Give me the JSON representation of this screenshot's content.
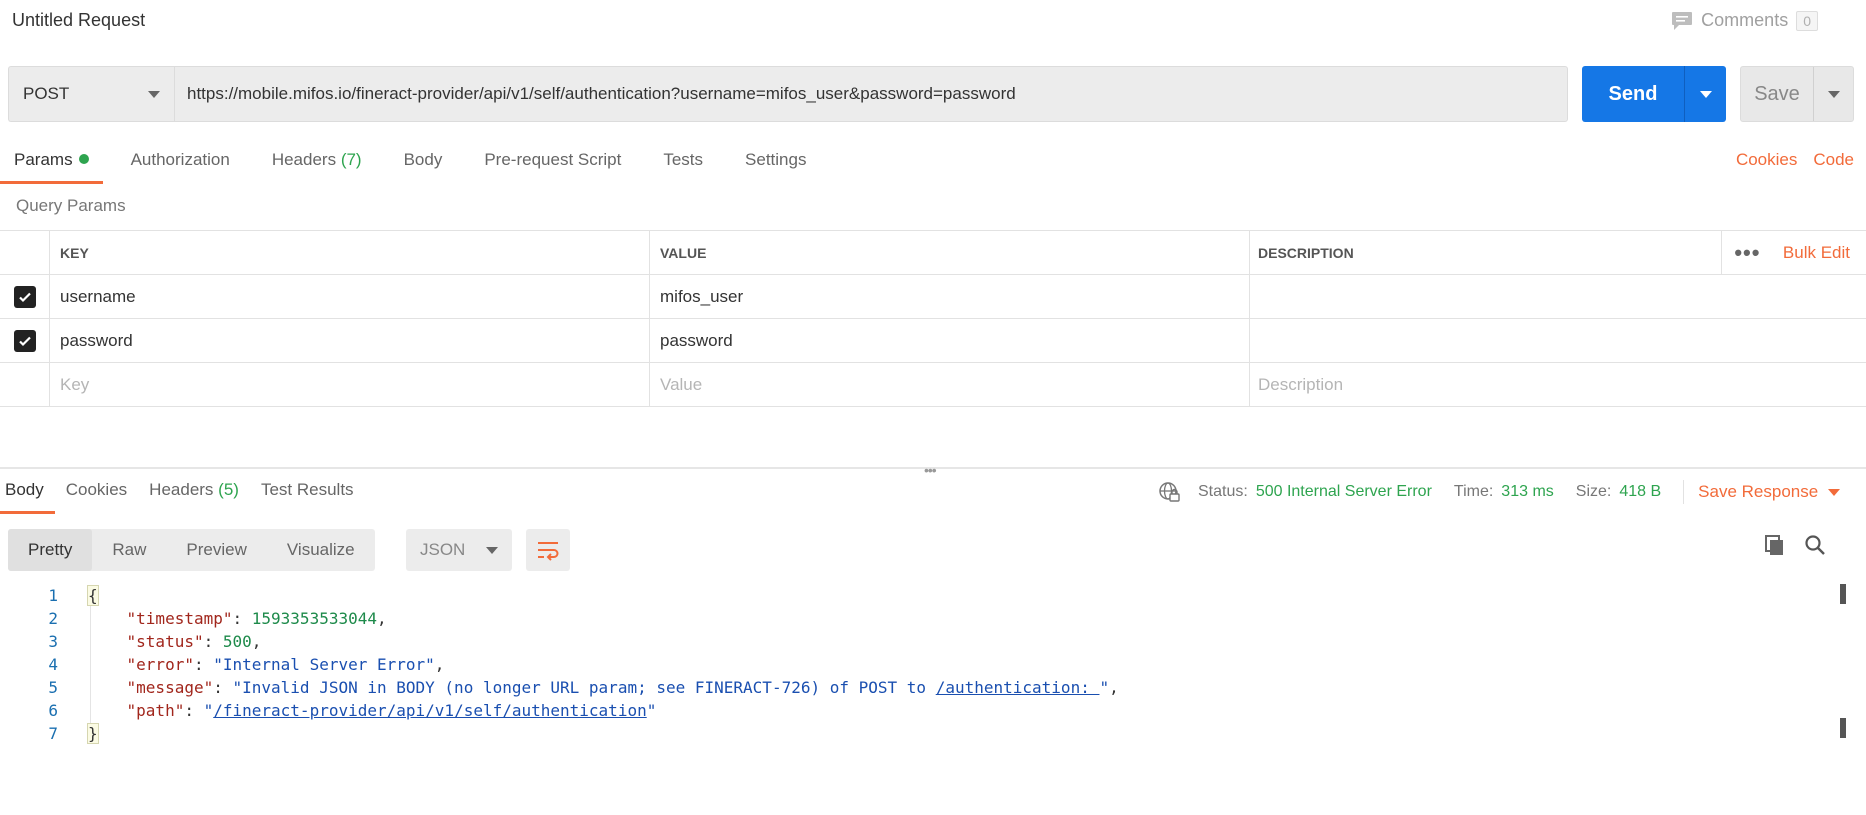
{
  "header": {
    "title": "Untitled Request",
    "comments_label": "Comments",
    "comments_count": "0"
  },
  "request": {
    "method": "POST",
    "url": "https://mobile.mifos.io/fineract-provider/api/v1/self/authentication?username=mifos_user&password=password",
    "send_label": "Send",
    "save_label": "Save"
  },
  "request_tabs": [
    {
      "label": "Params",
      "active": true,
      "indicator": "green-dot"
    },
    {
      "label": "Authorization"
    },
    {
      "label": "Headers",
      "count": "(7)"
    },
    {
      "label": "Body"
    },
    {
      "label": "Pre-request Script"
    },
    {
      "label": "Tests"
    },
    {
      "label": "Settings"
    }
  ],
  "right_links": {
    "cookies": "Cookies",
    "code": "Code"
  },
  "query_params": {
    "section_label": "Query Params",
    "headers": {
      "key": "KEY",
      "value": "VALUE",
      "description": "DESCRIPTION",
      "bulk_edit": "Bulk Edit"
    },
    "rows": [
      {
        "checked": true,
        "key": "username",
        "value": "mifos_user",
        "description": ""
      },
      {
        "checked": true,
        "key": "password",
        "value": "password",
        "description": ""
      }
    ],
    "placeholders": {
      "key": "Key",
      "value": "Value",
      "description": "Description"
    }
  },
  "response_tabs": [
    {
      "label": "Body",
      "active": true
    },
    {
      "label": "Cookies"
    },
    {
      "label": "Headers",
      "count": "(5)"
    },
    {
      "label": "Test Results"
    }
  ],
  "response_status": {
    "status_label": "Status:",
    "status_value": "500 Internal Server Error",
    "time_label": "Time:",
    "time_value": "313 ms",
    "size_label": "Size:",
    "size_value": "418 B",
    "save_response_label": "Save Response"
  },
  "response_view": {
    "modes": [
      "Pretty",
      "Raw",
      "Preview",
      "Visualize"
    ],
    "active_mode": "Pretty",
    "format": "JSON"
  },
  "response_body": {
    "line_numbers": [
      "1",
      "2",
      "3",
      "4",
      "5",
      "6",
      "7"
    ],
    "open_brace": "{",
    "close_brace": "}",
    "timestamp_key": "\"timestamp\"",
    "timestamp_value": "1593353533044",
    "status_key": "\"status\"",
    "status_value": "500",
    "error_key": "\"error\"",
    "error_value": "\"Internal Server Error\"",
    "message_key": "\"message\"",
    "message_value_a": "\"Invalid JSON in BODY (no longer URL param; see FINERACT-726) of POST to ",
    "message_value_link": "/authentication: ",
    "message_value_b": "\"",
    "path_key": "\"path\"",
    "path_value_a": "\"",
    "path_value_link": "/fineract-provider/api/v1/self/authentication",
    "path_value_b": "\""
  },
  "colors": {
    "accent": "#f26b3a",
    "send_blue": "#1577e6",
    "success_green": "#2ea44f"
  }
}
